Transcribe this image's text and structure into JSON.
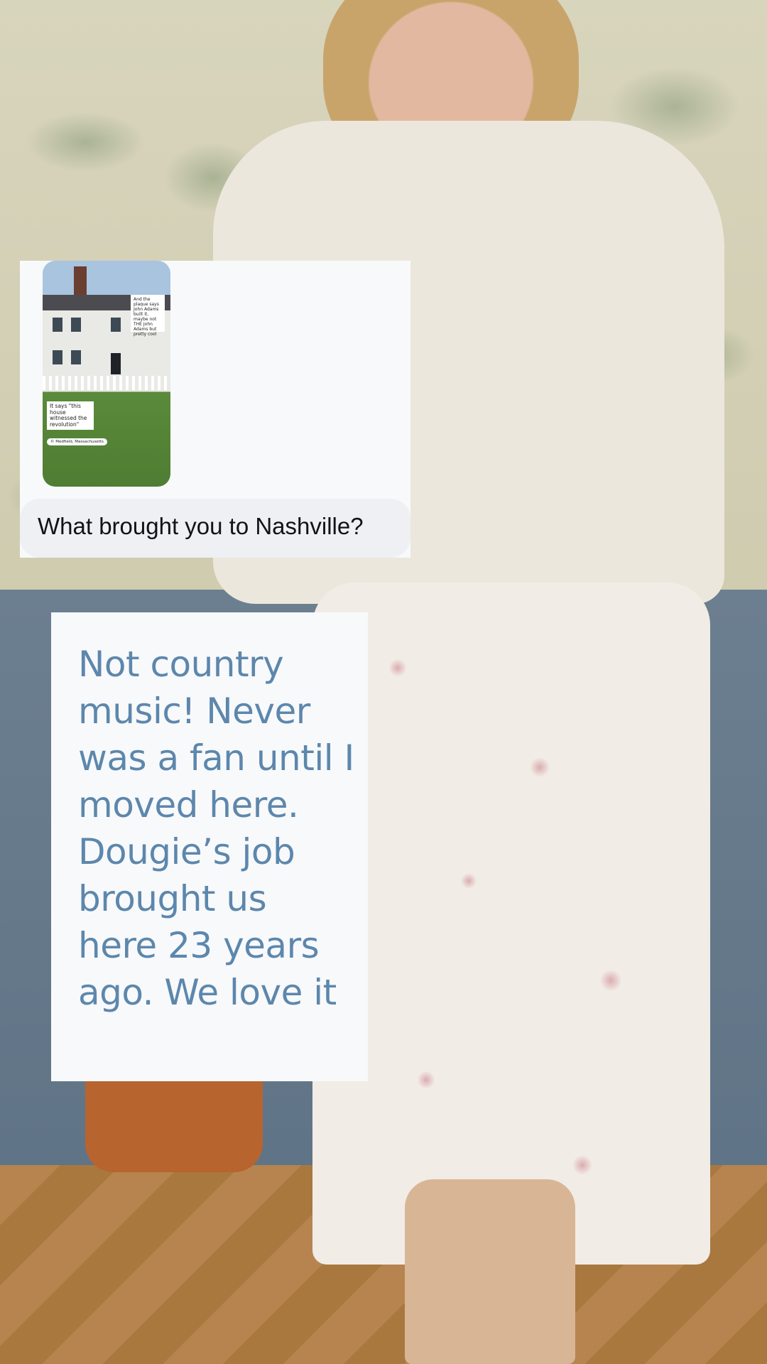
{
  "reply": {
    "question": "What brought you to Nashville?",
    "thumbnail": {
      "note_top": "And the plaque says John Adams built it, maybe not THE John Adams but pretty cool",
      "note_bottom": "It says \"this house witnessed the revolution\"",
      "location": "© Medfield, Massachusetts"
    }
  },
  "answer": {
    "text": "Not country music! Never was a fan until I moved here. Dougie’s job brought us here 23 years ago. We love it"
  },
  "colors": {
    "answer_text": "#5d87ac",
    "card_bg": "#f8f9fb",
    "bubble_bg": "#eef0f4"
  }
}
